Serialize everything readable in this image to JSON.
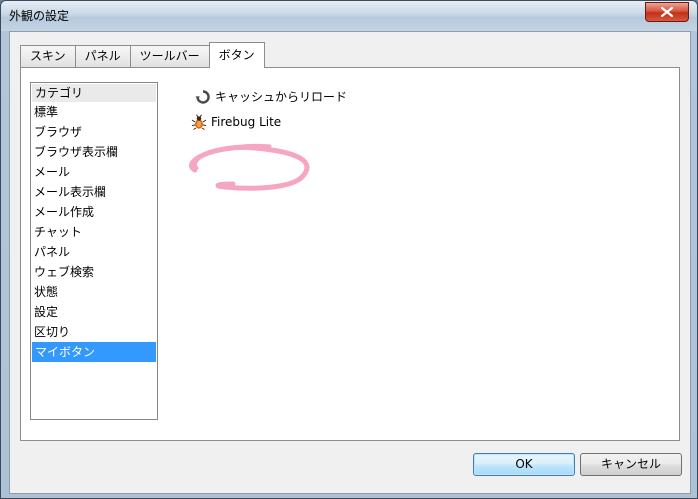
{
  "window": {
    "title": "外観の設定"
  },
  "tabs": [
    {
      "label": "スキン",
      "active": false
    },
    {
      "label": "パネル",
      "active": false
    },
    {
      "label": "ツールバー",
      "active": false
    },
    {
      "label": "ボタン",
      "active": true
    }
  ],
  "category_list": {
    "items": [
      {
        "label": "カテゴリ",
        "kind": "header"
      },
      {
        "label": "標準"
      },
      {
        "label": "ブラウザ"
      },
      {
        "label": "ブラウザ表示欄"
      },
      {
        "label": "メール"
      },
      {
        "label": "メール表示欄"
      },
      {
        "label": "メール作成"
      },
      {
        "label": "チャット"
      },
      {
        "label": "パネル"
      },
      {
        "label": "ウェブ検索"
      },
      {
        "label": "状態"
      },
      {
        "label": "設定"
      },
      {
        "label": "区切り"
      },
      {
        "label": "マイボタン",
        "kind": "selected"
      }
    ]
  },
  "custom_buttons": [
    {
      "label": "キャッシュからリロード",
      "icon": "reload-icon"
    },
    {
      "label": "Firebug Lite",
      "icon": "firebug-icon"
    }
  ],
  "footer": {
    "ok_label": "OK",
    "cancel_label": "キャンセル"
  },
  "colors": {
    "selection": "#3399ff",
    "highlight_scribble": "#f4a6c2",
    "close_button": "#c0301a"
  }
}
